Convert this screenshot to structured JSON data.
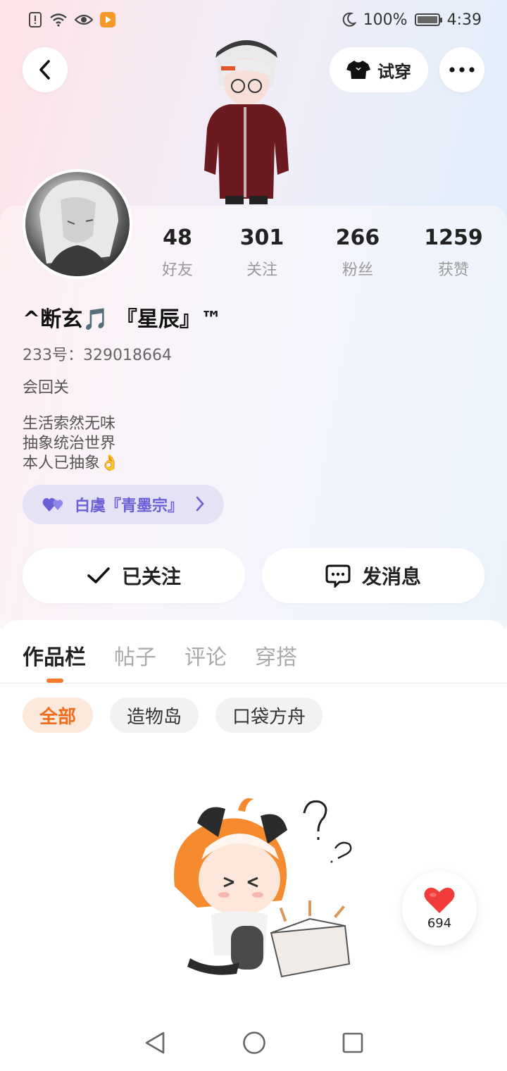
{
  "status_bar": {
    "battery_percent": "100%",
    "time": "4:39",
    "icons": [
      "alert-icon",
      "wifi-icon",
      "eye-icon",
      "app-play-icon",
      "moon-icon",
      "battery-icon"
    ]
  },
  "header": {
    "try_on_label": "试穿"
  },
  "profile": {
    "stats": [
      {
        "value": "48",
        "label": "好友"
      },
      {
        "value": "301",
        "label": "关注"
      },
      {
        "value": "266",
        "label": "粉丝"
      },
      {
        "value": "1259",
        "label": "获赞"
      }
    ],
    "username": "^断玄🎵 『星辰』™",
    "uid": "233号：329018664",
    "status": "会回关",
    "bio_lines": [
      "生活索然无味",
      "抽象统治世界",
      "本人已抽象👌"
    ],
    "guild": "白虞『青墨宗』"
  },
  "actions": {
    "follow_label": "已关注",
    "message_label": "发消息"
  },
  "tabs": [
    "作品栏",
    "帖子",
    "评论",
    "穿搭"
  ],
  "filters": [
    "全部",
    "造物岛",
    "口袋方舟"
  ],
  "likes": {
    "count": "694"
  },
  "colors": {
    "accent": "#f47a2d",
    "guild": "#6b5fd6",
    "heart": "#f23c3c"
  }
}
